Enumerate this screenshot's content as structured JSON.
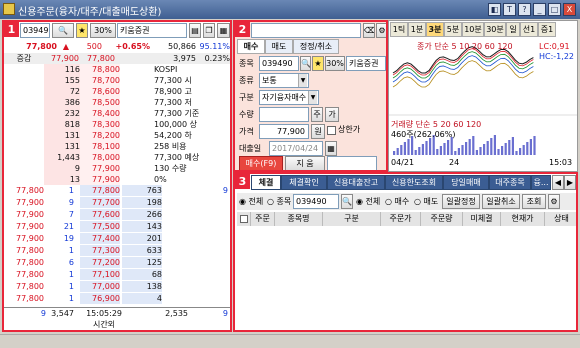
{
  "window": {
    "title": "신용주문(융자/대주/대출매도상환)",
    "controls": [
      "◧",
      "T",
      "?",
      "_",
      "□",
      "X"
    ]
  },
  "panel1": {
    "badge": "1",
    "code": "039490",
    "stock_kind": "30%",
    "stock_name": "키움증권",
    "price": "77,800",
    "change": "500",
    "change_rate": "+0.65%",
    "volume": "50,866",
    "vol_ratio": "95.11%",
    "hdr": {
      "c1": "증감",
      "c2": "77,900",
      "c3": "77,800",
      "c4": "3,975",
      "c5": "0.23%"
    },
    "asks": [
      {
        "qty": "116",
        "price": "78,800",
        "info": "KOSPI"
      },
      {
        "qty": "155",
        "price": "78,700",
        "info": "77,300 시"
      },
      {
        "qty": "72",
        "price": "78,600",
        "info": "78,900 고"
      },
      {
        "qty": "386",
        "price": "78,500",
        "info": "77,300 저"
      },
      {
        "qty": "232",
        "price": "78,400",
        "info": "77,300 기준"
      },
      {
        "qty": "818",
        "price": "78,300",
        "info": "100,000 상"
      },
      {
        "qty": "131",
        "price": "78,200",
        "info": "54,200 하"
      },
      {
        "qty": "131",
        "price": "78,100",
        "info": "258 비용"
      },
      {
        "qty": "1,443",
        "price": "78,000",
        "info": "77,300 예상"
      },
      {
        "qty": "9",
        "price": "77,900",
        "info": "130 수량"
      },
      {
        "qty": "13",
        "price": "77,900",
        "info": "0%"
      }
    ],
    "bids": [
      {
        "t": "77,800",
        "n": "1",
        "price": "77,800",
        "qty": "763",
        "x": "9"
      },
      {
        "t": "77,900",
        "n": "9",
        "price": "77,700",
        "qty": "198",
        "x": ""
      },
      {
        "t": "77,900",
        "n": "7",
        "price": "77,600",
        "qty": "266",
        "x": ""
      },
      {
        "t": "77,900",
        "n": "21",
        "price": "77,500",
        "qty": "143",
        "x": ""
      },
      {
        "t": "77,900",
        "n": "19",
        "price": "77,400",
        "qty": "201",
        "x": ""
      },
      {
        "t": "77,800",
        "n": "1",
        "price": "77,300",
        "qty": "633",
        "x": ""
      },
      {
        "t": "77,800",
        "n": "6",
        "price": "77,200",
        "qty": "125",
        "x": ""
      },
      {
        "t": "77,800",
        "n": "1",
        "price": "77,100",
        "qty": "68",
        "x": ""
      },
      {
        "t": "77,800",
        "n": "1",
        "price": "77,000",
        "qty": "138",
        "x": ""
      },
      {
        "t": "77,800",
        "n": "1",
        "price": "76,900",
        "qty": "4",
        "x": ""
      }
    ],
    "footer": {
      "f1": "9",
      "f2": "3,547",
      "f3": "15:05:29",
      "f4": "2,535",
      "f5": "9",
      "f6": "시간외"
    }
  },
  "panel2": {
    "badge": "2",
    "tabs": [
      "매수",
      "매도",
      "정정/취소"
    ],
    "code_label": "종목",
    "code": "039490",
    "stock_kind": "30%",
    "stock_name": "키움증권",
    "type_label": "종류",
    "type": "보통",
    "kind_label": "구분",
    "kind": "자기융자매수",
    "qty_label": "수량",
    "qty": "",
    "qty_btn": "주",
    "qty_btn2": "가",
    "price_label": "가격",
    "price": "77,900",
    "won": "원",
    "market_label": "상한가",
    "date_label": "대출일",
    "date": "2017/04/24",
    "buy_btn": "매수(F9)",
    "clear_btn": "지 움"
  },
  "chart": {
    "tabs": [
      "1틱",
      "1분",
      "3분",
      "5분",
      "10분",
      "30분",
      "일",
      "선1",
      "증1"
    ],
    "upper_label": "종가 단순 5 10 20 60 120",
    "lc": "LC:0,91",
    "hc": "HC:-1,22",
    "lower_label": "거래량 단순 5 20 60 120",
    "vol_val": "460주(262.06%)",
    "date": "04/21",
    "date2": "24",
    "time": "15:03",
    "colors": {
      "line": "#1a1a1a",
      "ma5": "#e0242f",
      "ma10": "#1a8f2a",
      "ma20": "#1c52d0",
      "ma60": "#b58c1a",
      "vol": "#6a6fd0"
    }
  },
  "panel3": {
    "badge": "3",
    "tabs": [
      "체결",
      "체결확인",
      "신용대출잔고",
      "신용한도조회",
      "당일매매",
      "대주종목",
      "융..."
    ],
    "radio_all": "전체",
    "radio_code": "종목",
    "code": "039490",
    "radio_all2": "전체",
    "radio_buy": "매수",
    "radio_sell": "매도",
    "btn_modify": "일괄정정",
    "btn_cancel": "일괄취소",
    "btn_query": "조회",
    "columns": [
      "주문",
      "종목명",
      "구분",
      "주문가",
      "주문량",
      "미체결",
      "현재가",
      "상태"
    ]
  }
}
